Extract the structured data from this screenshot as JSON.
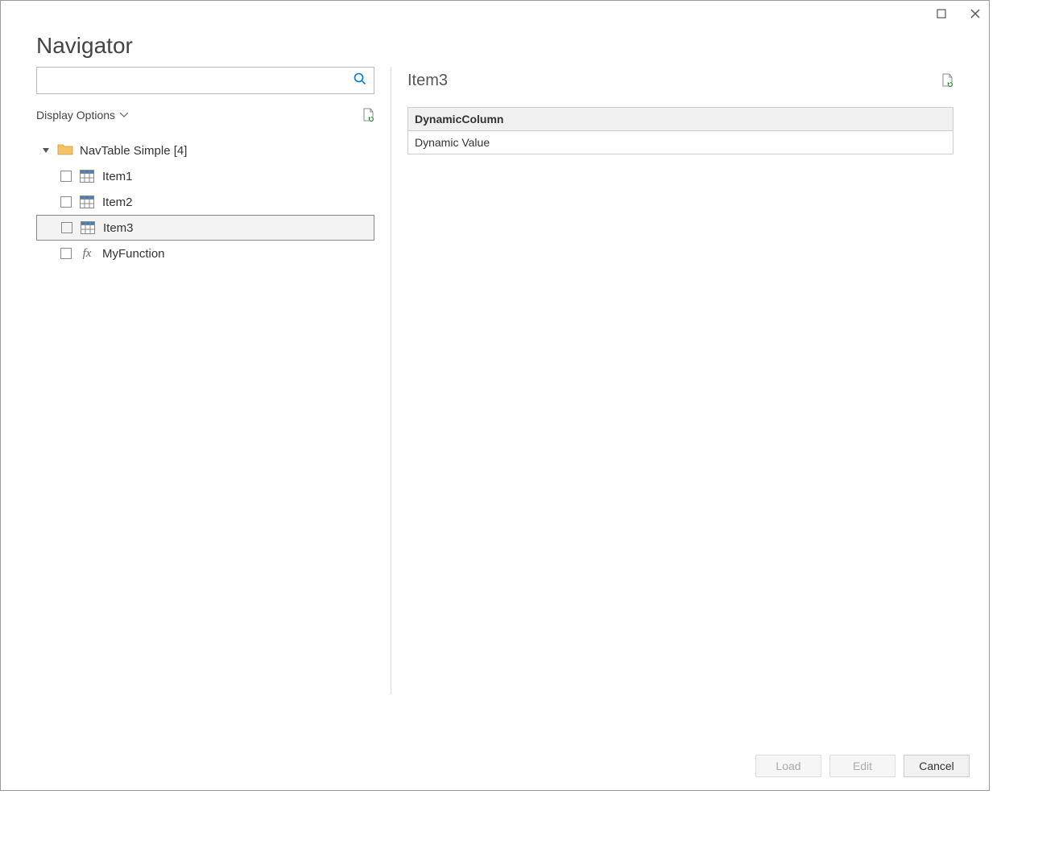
{
  "window": {
    "title": "Navigator"
  },
  "search": {
    "value": "",
    "placeholder": ""
  },
  "display_options_label": "Display Options",
  "tree": {
    "root": {
      "label": "NavTable Simple [4]",
      "expanded": true,
      "children": [
        {
          "label": "Item1",
          "kind": "table",
          "checked": false,
          "selected": false
        },
        {
          "label": "Item2",
          "kind": "table",
          "checked": false,
          "selected": false
        },
        {
          "label": "Item3",
          "kind": "table",
          "checked": false,
          "selected": true
        },
        {
          "label": "MyFunction",
          "kind": "function",
          "checked": false,
          "selected": false
        }
      ]
    }
  },
  "preview": {
    "title": "Item3",
    "columns": [
      "DynamicColumn"
    ],
    "rows": [
      [
        "Dynamic Value"
      ]
    ]
  },
  "footer": {
    "load": "Load",
    "edit": "Edit",
    "cancel": "Cancel"
  }
}
